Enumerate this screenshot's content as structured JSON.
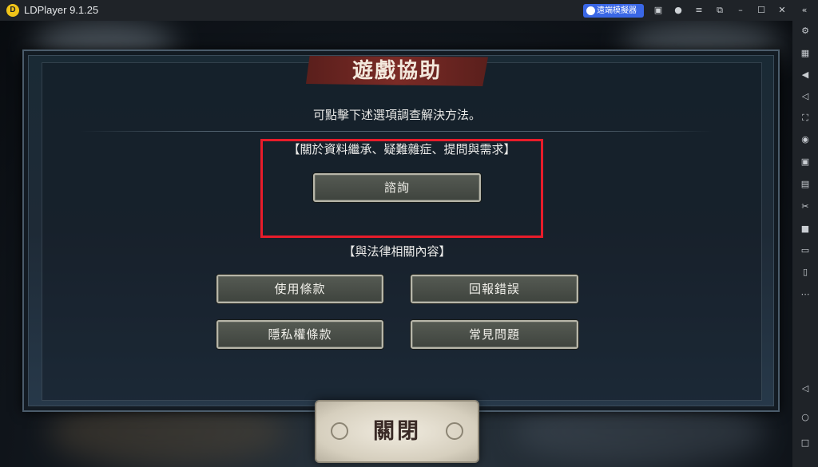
{
  "window": {
    "title": "LDPlayer 9.1.25",
    "logo_text": "D",
    "remote_button_label": "遠端模擬器",
    "titlebar_icons": [
      "gift-icon",
      "user-icon",
      "menu-icon",
      "restore-icon",
      "minimize-icon",
      "maximize-icon",
      "close-icon",
      "collapse-sidebar-icon"
    ]
  },
  "sidebar": {
    "icons": [
      "settings-icon",
      "keyboard-icon",
      "volume-up-icon",
      "volume-down-icon",
      "screenshot-icon",
      "location-icon",
      "sync-icon",
      "apk-icon",
      "scissors-icon",
      "record-icon",
      "folder-icon",
      "shake-icon",
      "more-icon",
      "back-icon",
      "home-icon",
      "recent-apps-icon"
    ]
  },
  "dialog": {
    "title": "遊戲協助",
    "subtitle": "可點擊下述選項調查解決方法。",
    "section1_label": "【關於資料繼承、疑難雜症、提問與需求】",
    "consult_button": "諮詢",
    "section2_label": "【與法律相關內容】",
    "terms_button": "使用條款",
    "report_button": "回報錯誤",
    "privacy_button": "隱私權條款",
    "faq_button": "常見問題",
    "close_button": "關閉"
  },
  "colors": {
    "highlight": "#e81c2a",
    "title_banner": "#7b2b26",
    "remote_button": "#3a67e6"
  }
}
